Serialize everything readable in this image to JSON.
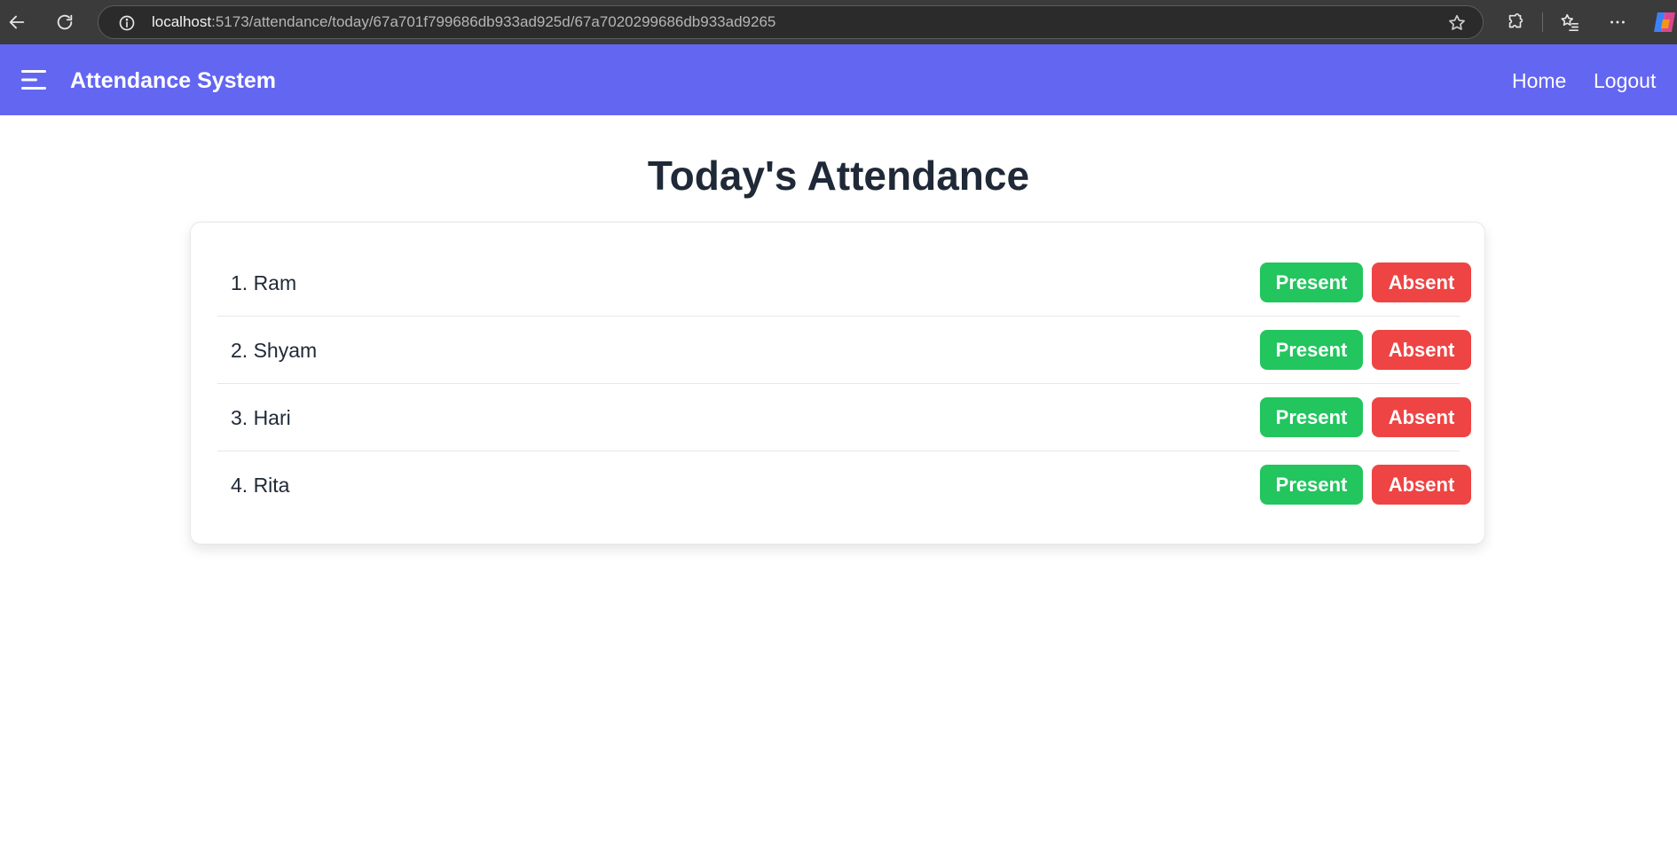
{
  "browser": {
    "url_host": "localhost",
    "url_path": ":5173/attendance/today/67a701f799686db933ad925d/67a7020299686db933ad9265"
  },
  "navbar": {
    "brand": "Attendance System",
    "links": [
      {
        "label": "Home"
      },
      {
        "label": "Logout"
      }
    ]
  },
  "page": {
    "title": "Today's Attendance"
  },
  "students": [
    {
      "name": "1. Ram",
      "present_label": "Present",
      "absent_label": "Absent"
    },
    {
      "name": "2. Shyam",
      "present_label": "Present",
      "absent_label": "Absent"
    },
    {
      "name": "3. Hari",
      "present_label": "Present",
      "absent_label": "Absent"
    },
    {
      "name": "4. Rita",
      "present_label": "Present",
      "absent_label": "Absent"
    }
  ],
  "colors": {
    "navbar": "#6366f1",
    "present": "#22c55e",
    "absent": "#ef4444",
    "title": "#1f2937"
  },
  "icons": {
    "back": "back-arrow-icon",
    "refresh": "refresh-icon",
    "info": "info-icon",
    "favorite": "star-icon",
    "extensions": "puzzle-icon",
    "favorites": "favorites-list-icon",
    "more": "more-icon",
    "copilot": "copilot-icon",
    "menu": "hamburger-menu-icon"
  }
}
